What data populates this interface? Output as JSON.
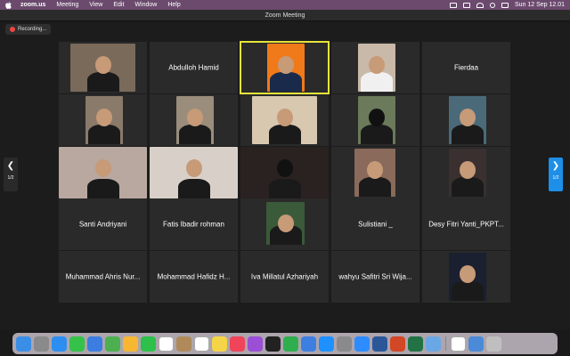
{
  "menubar": {
    "app": "zoom.us",
    "items": [
      "Meeting",
      "View",
      "Edit",
      "Window",
      "Help"
    ],
    "clock": "Sun 12 Sep  12.01"
  },
  "window": {
    "title": "Zoom Meeting"
  },
  "recording": {
    "label": "Recording..."
  },
  "pager": {
    "left_label": "1/2",
    "right_label": "1/2"
  },
  "participants": [
    {
      "name": "",
      "video": true
    },
    {
      "name": "Abdulloh Hamid",
      "video": false
    },
    {
      "name": "",
      "video": true,
      "active": true
    },
    {
      "name": "",
      "video": true
    },
    {
      "name": "Fierdaa",
      "video": false
    },
    {
      "name": "",
      "video": true
    },
    {
      "name": "",
      "video": true
    },
    {
      "name": "",
      "video": true
    },
    {
      "name": "",
      "video": true
    },
    {
      "name": "",
      "video": true
    },
    {
      "name": "",
      "video": true
    },
    {
      "name": "",
      "video": true
    },
    {
      "name": "",
      "video": true
    },
    {
      "name": "",
      "video": true
    },
    {
      "name": "",
      "video": true
    },
    {
      "name": "Santi Andriyani",
      "video": false
    },
    {
      "name": "Fatis Ibadir rohman",
      "video": false
    },
    {
      "name": "",
      "video": true
    },
    {
      "name": "Sulistiani _",
      "video": false
    },
    {
      "name": "Desy Fitri Yanti_PKPT...",
      "video": false
    },
    {
      "name": "Muhammad Ahris Nur...",
      "video": false
    },
    {
      "name": "Mohammad Hafidz H...",
      "video": false
    },
    {
      "name": "Iva Millatul Azhariyah",
      "video": false
    },
    {
      "name": "wahyu Safitri Sri Wija...",
      "video": false
    },
    {
      "name": "",
      "video": true
    }
  ],
  "dock": {
    "icons": [
      "finder-icon",
      "launchpad-icon",
      "safari-icon",
      "messages-icon",
      "mail-icon",
      "maps-icon",
      "photos-icon",
      "facetime-icon",
      "calendar-icon",
      "contacts-icon",
      "reminders-icon",
      "notes-icon",
      "music-icon",
      "podcasts-icon",
      "tv-icon",
      "numbers-icon",
      "keynote-icon",
      "appstore-icon",
      "settings-icon",
      "zoom-icon",
      "word-icon",
      "powerpoint-icon",
      "excel-icon",
      "preview-icon",
      "chrome-icon",
      "downloads-icon",
      "trash-icon"
    ],
    "colors": [
      "#3a8ee6",
      "#8a8a8a",
      "#2d8ef0",
      "#36c24a",
      "#3b7de0",
      "#4caf50",
      "#f7b733",
      "#2ec04a",
      "#ffffff",
      "#b08a5a",
      "#ffffff",
      "#f5d547",
      "#f0445a",
      "#9b4fd6",
      "#222222",
      "#2fae4e",
      "#3d7fe0",
      "#1e90ff",
      "#8a8a8a",
      "#2d8cff",
      "#2b579a",
      "#d24726",
      "#217346",
      "#6aa7e6",
      "#ffffff",
      "#4a8ad8",
      "#bfbfbf"
    ]
  }
}
